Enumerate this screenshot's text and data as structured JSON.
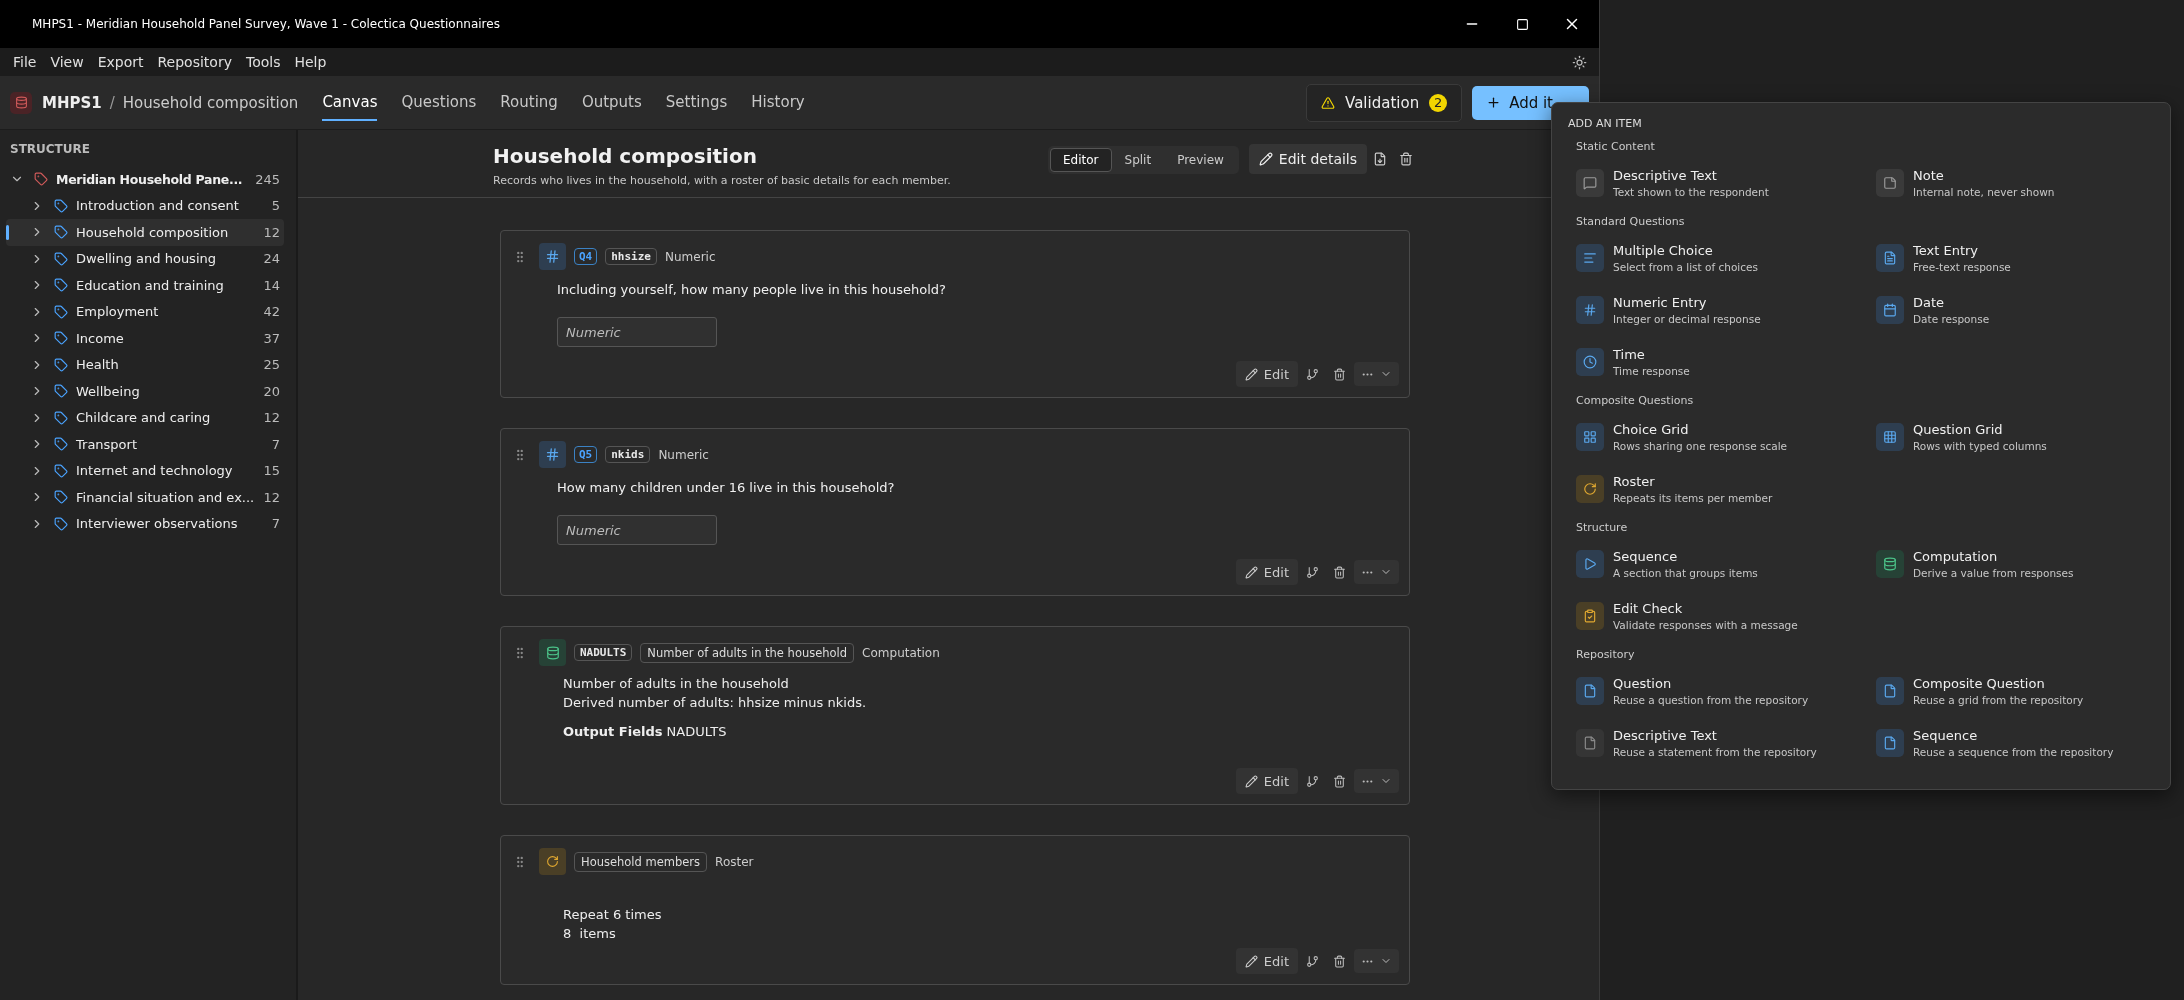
{
  "window": {
    "title": "MHPS1 - Meridian Household Panel Survey, Wave 1 - Colectica Questionnaires"
  },
  "menu_bar": [
    "File",
    "View",
    "Export",
    "Repository",
    "Tools",
    "Help"
  ],
  "breadcrumb": {
    "project": "MHPS1",
    "separator": "/",
    "current": "Household composition"
  },
  "tabs": [
    {
      "label": "Canvas",
      "selected": true
    },
    {
      "label": "Questions",
      "selected": false
    },
    {
      "label": "Routing",
      "selected": false
    },
    {
      "label": "Outputs",
      "selected": false
    },
    {
      "label": "Settings",
      "selected": false
    },
    {
      "label": "History",
      "selected": false
    }
  ],
  "validation": {
    "label": "Validation",
    "count": "2"
  },
  "add_button": {
    "label": "Add it"
  },
  "sidebar": {
    "heading": "STRUCTURE",
    "tree": [
      {
        "label": "Meridian Household Pane...",
        "count": "245",
        "expanded": true,
        "selected": false,
        "children": [
          {
            "label": "Introduction and consent",
            "count": "5",
            "expanded": false,
            "selected": false
          },
          {
            "label": "Household composition",
            "count": "12",
            "expanded": false,
            "selected": true
          },
          {
            "label": "Dwelling and housing",
            "count": "24",
            "expanded": false,
            "selected": false
          },
          {
            "label": "Education and training",
            "count": "14",
            "expanded": false,
            "selected": false
          },
          {
            "label": "Employment",
            "count": "42",
            "expanded": false,
            "selected": false
          },
          {
            "label": "Income",
            "count": "37",
            "expanded": false,
            "selected": false
          },
          {
            "label": "Health",
            "count": "25",
            "expanded": false,
            "selected": false
          },
          {
            "label": "Wellbeing",
            "count": "20",
            "expanded": false,
            "selected": false
          },
          {
            "label": "Childcare and caring",
            "count": "12",
            "expanded": false,
            "selected": false
          },
          {
            "label": "Transport",
            "count": "7",
            "expanded": false,
            "selected": false
          },
          {
            "label": "Internet and technology",
            "count": "15",
            "expanded": false,
            "selected": false
          },
          {
            "label": "Financial situation and ex...",
            "count": "12",
            "expanded": false,
            "selected": false
          },
          {
            "label": "Interviewer observations",
            "count": "7",
            "expanded": false,
            "selected": false
          }
        ]
      }
    ]
  },
  "page_header": {
    "title": "Household composition",
    "description": "Records who lives in the household, with a roster of basic details for each member.",
    "view_modes": [
      {
        "label": "Editor",
        "selected": true
      },
      {
        "label": "Split",
        "selected": false
      },
      {
        "label": "Preview",
        "selected": false
      }
    ],
    "edit_button": "Edit details"
  },
  "items": [
    {
      "kind": "numeric",
      "number": "Q4",
      "name": "hhsize",
      "type": "Numeric",
      "question": "Including yourself, how many people live in this household?",
      "placeholder": "Numeric",
      "edit": "Edit"
    },
    {
      "kind": "numeric",
      "number": "Q5",
      "name": "nkids",
      "type": "Numeric",
      "question": "How many children under 16 live in this household?",
      "placeholder": "Numeric",
      "edit": "Edit"
    },
    {
      "kind": "computation",
      "name": "NADULTS",
      "label": "Number of adults in the household",
      "type": "Computation",
      "lines": [
        "Number of adults in the household",
        "Derived number of adults: hhsize minus nkids."
      ],
      "output": "**Output Fields** NADULTS",
      "edit": "Edit"
    },
    {
      "kind": "roster",
      "label": "Household members",
      "type": "Roster",
      "lines": [
        "Repeat 6 times",
        "8  items"
      ],
      "edit": "Edit"
    }
  ],
  "add_menu": {
    "title": "ADD AN ITEM",
    "sections": [
      {
        "heading": "Static Content",
        "items": [
          {
            "kind": "descriptive-text",
            "title": "Descriptive Text",
            "subtitle": "Text shown to the respondent"
          },
          {
            "kind": "note",
            "title": "Note",
            "subtitle": "Internal note, never shown"
          }
        ]
      },
      {
        "heading": "Standard Questions",
        "items": [
          {
            "kind": "multiple-choice",
            "title": "Multiple Choice",
            "subtitle": "Select from a list of choices"
          },
          {
            "kind": "text-entry",
            "title": "Text Entry",
            "subtitle": "Free-text response"
          },
          {
            "kind": "numeric-entry",
            "title": "Numeric Entry",
            "subtitle": "Integer or decimal response"
          },
          {
            "kind": "date",
            "title": "Date",
            "subtitle": "Date response"
          },
          {
            "kind": "time",
            "title": "Time",
            "subtitle": "Time response"
          }
        ]
      },
      {
        "heading": "Composite Questions",
        "items": [
          {
            "kind": "choice-grid",
            "title": "Choice Grid",
            "subtitle": "Rows sharing one response scale"
          },
          {
            "kind": "question-grid",
            "title": "Question Grid",
            "subtitle": "Rows with typed columns"
          },
          {
            "kind": "roster",
            "title": "Roster",
            "subtitle": "Repeats its items per member"
          }
        ]
      },
      {
        "heading": "Structure",
        "items": [
          {
            "kind": "sequence",
            "title": "Sequence",
            "subtitle": "A section that groups items"
          },
          {
            "kind": "computation",
            "title": "Computation",
            "subtitle": "Derive a value from responses"
          },
          {
            "kind": "edit-check",
            "title": "Edit Check",
            "subtitle": "Validate responses with a message"
          }
        ]
      },
      {
        "heading": "Repository",
        "items": [
          {
            "kind": "repo-question",
            "title": "Question",
            "subtitle": "Reuse a question from the repository"
          },
          {
            "kind": "repo-composite",
            "title": "Composite Question",
            "subtitle": "Reuse a grid from the repository"
          },
          {
            "kind": "repo-text",
            "title": "Descriptive Text",
            "subtitle": "Reuse a statement from the repository"
          },
          {
            "kind": "repo-sequence",
            "title": "Sequence",
            "subtitle": "Reuse a sequence from the repository"
          }
        ]
      }
    ]
  }
}
